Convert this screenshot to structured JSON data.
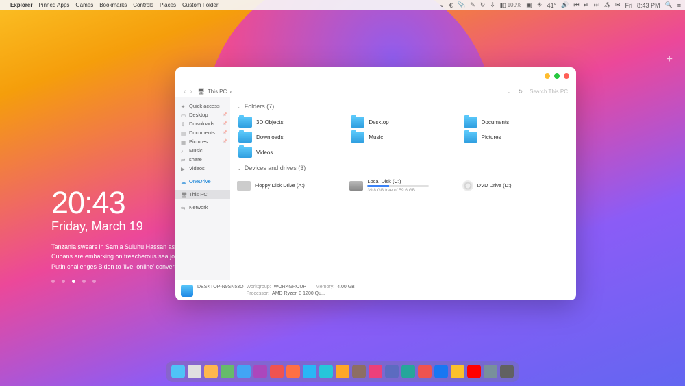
{
  "menubar": {
    "app": "Explorer",
    "items": [
      "Pinned Apps",
      "Games",
      "Bookmarks",
      "Controls",
      "Places",
      "Custom Folder"
    ],
    "battery": "100%",
    "temp": "41°",
    "day": "Fri",
    "time": "8:43 PM"
  },
  "widget": {
    "time": "20:43",
    "date": "Friday, March 19",
    "news": [
      "Tanzania swears in Samia Suluhu Hassan as fir",
      "Cubans are embarking on treacherous sea jou",
      "Putin challenges Biden to 'live, online' conversa"
    ]
  },
  "window": {
    "breadcrumb": "This PC",
    "search_placeholder": "Search This PC",
    "sidebar": {
      "quick": "Quick access",
      "items": [
        "Desktop",
        "Downloads",
        "Documents",
        "Pictures",
        "Music",
        "share",
        "Videos"
      ],
      "onedrive": "OneDrive",
      "thispc": "This PC",
      "network": "Network"
    },
    "folders_header": "Folders (7)",
    "folders": [
      "3D Objects",
      "Desktop",
      "Documents",
      "Downloads",
      "Music",
      "Pictures",
      "Videos"
    ],
    "drives_header": "Devices and drives (3)",
    "drives": {
      "floppy": "Floppy Disk Drive (A:)",
      "local": {
        "name": "Local Disk (C:)",
        "sub": "39.8 GB free of 59.6 GB"
      },
      "dvd": "DVD Drive (D:)"
    },
    "status": {
      "computer": "DESKTOP-N9SN53O",
      "wg_label": "Workgroup:",
      "wg": "WORKGROUP",
      "mem_label": "Memory:",
      "mem": "4.00 GB",
      "proc_label": "Processor:",
      "proc": "AMD Ryzen 3 1200 Qu..."
    }
  },
  "dock_colors": [
    "#4fc3f7",
    "#e0e0e0",
    "#ffb74d",
    "#66bb6a",
    "#42a5f5",
    "#ab47bc",
    "#ef5350",
    "#ff7043",
    "#29b6f6",
    "#26c6da",
    "#ffa726",
    "#8d6e63",
    "#ec407a",
    "#5c6bc0",
    "#26a69a",
    "#ef5350",
    "#1877f2",
    "#fbc02d",
    "#ff0000",
    "#78909c",
    "#616161"
  ]
}
